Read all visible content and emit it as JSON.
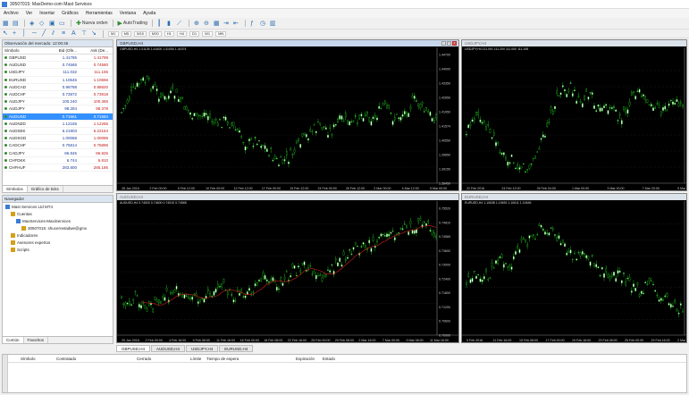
{
  "window": {
    "title": "30507015: MaxDemo-com Mast Services"
  },
  "menu": [
    "Archivo",
    "Ver",
    "Insertar",
    "Gráficos",
    "Herramientas",
    "Ventana",
    "Ayuda"
  ],
  "toolbar": {
    "new_order": "Nueva orden",
    "autotrading": "AutoTrading",
    "timeframes": [
      "M1",
      "M5",
      "M15",
      "M30",
      "H1",
      "H4",
      "D1",
      "W1",
      "MN"
    ]
  },
  "market_watch": {
    "title": "Observación del mercado: 12:00:45",
    "headers": {
      "symbol": "Símbolo",
      "bid": "Bid (Ofe...",
      "ask": "Ask (De..."
    },
    "rows": [
      {
        "symbol": "GBPUSD",
        "bid": "1.41785",
        "ask": "1.41799"
      },
      {
        "symbol": "AUDUSD",
        "bid": "0.74565",
        "ask": "0.74580"
      },
      {
        "symbol": "USDJPY",
        "bid": "111.032",
        "ask": "111.155"
      },
      {
        "symbol": "EURUSD",
        "bid": "1.10645",
        "ask": "1.10656"
      },
      {
        "symbol": "AUDCAD",
        "bid": "0.98788",
        "ask": "0.98820"
      },
      {
        "symbol": "AUDCHF",
        "bid": "0.73872",
        "ask": "0.73918"
      },
      {
        "symbol": "AUDJPY",
        "bid": "100.240",
        "ask": "100.365"
      },
      {
        "symbol": "AUDJPY",
        "bid": "98.284",
        "ask": "98.378"
      },
      {
        "symbol": "AUDUSD",
        "bid": "0.71561",
        "ask": "0.71584"
      },
      {
        "symbol": "AUDNZD",
        "bid": "1.12165",
        "ask": "1.12265"
      },
      {
        "symbol": "AUDSEK",
        "bid": "6.21903",
        "ask": "6.22164"
      },
      {
        "symbol": "AUDSGD",
        "bid": "1.00068",
        "ask": "1.00086"
      },
      {
        "symbol": "CADCHF",
        "bid": "0.75814",
        "ask": "0.75896"
      },
      {
        "symbol": "CADJPY",
        "bid": "86.845",
        "ask": "86.925"
      },
      {
        "symbol": "CHFDKK",
        "bid": "6.744",
        "ask": "6.810"
      },
      {
        "symbol": "CHFHUF",
        "bid": "283.800",
        "ask": "285.186"
      }
    ],
    "selected_index": 8,
    "tabs": [
      "Símbolos",
      "Gráfico de ticks"
    ]
  },
  "navigator": {
    "title": "Navegador",
    "items": [
      {
        "label": "Mast Services Ltd MT4",
        "indent": 0,
        "color": "#3a7bd5"
      },
      {
        "label": "Cuentas",
        "indent": 1,
        "color": "#d4a017"
      },
      {
        "label": "MaxServices-MaxiServices",
        "indent": 2,
        "color": "#3a7bd5"
      },
      {
        "label": "30507015: shucernetadwe@gmx",
        "indent": 3,
        "color": "#d4a017"
      },
      {
        "label": "Indicadores",
        "indent": 1,
        "color": "#d4a017"
      },
      {
        "label": "Asesores expertos",
        "indent": 1,
        "color": "#d4a017"
      },
      {
        "label": "Scripts",
        "indent": 1,
        "color": "#d4a017"
      }
    ],
    "tabs": [
      "Común",
      "Favoritos"
    ]
  },
  "charts": [
    {
      "title": "GBPUSD,H4",
      "info": "GBPUSD,H4  1.41105 1.41600 1.41050 1.41574",
      "active": true,
      "y_labels": [
        "1.44700",
        "1.44000",
        "1.43350",
        "1.42650",
        "1.41950",
        "1.41574",
        "1.40550",
        "1.39850",
        "1.39150",
        "1.38450"
      ],
      "x_labels": [
        "28 Jan 2016",
        "2 Feb 00:00",
        "5 Feb 12:00",
        "10 Feb 00:00",
        "12 Feb 12:00",
        "17 Feb 00:00",
        "19 Feb 12:00",
        "24 Feb 00:00",
        "26 Feb 12:00",
        "2 Mar 00:00",
        "4 Mar 12:00",
        "9 Mar 00:00"
      ]
    },
    {
      "title": "USDJPY,H4",
      "info": "USDJPY,H4  111.091 111.200 111.000 111.155",
      "active": false,
      "y_labels": [],
      "x_labels": [
        "22 Feb 2016",
        "24 Feb 12:00",
        "26 Feb 04:00",
        "1 Mar 00:00",
        "3 Mar 00:00",
        "7 Mar 20:00",
        "9 Mar 00:00"
      ]
    },
    {
      "title": "AUDUSD,H4",
      "info": "AUDUSD,H4  0.74520 0.74600 0.74510 0.74565",
      "active": false,
      "y_labels": [
        "0.75520",
        "0.74810",
        "0.74565",
        "0.73600",
        "0.73000",
        "0.72400",
        "0.71800",
        "0.71200",
        "0.70600",
        "0.70000"
      ],
      "x_labels": [
        "29 Jan 2016",
        "2 Feb 00:00",
        "4 Feb 16:00",
        "9 Feb 08:00",
        "11 Feb 16:00",
        "16 Feb 00:00",
        "18 Feb 08:00",
        "22 Feb 16:00",
        "25 Feb 00:00",
        "29 Feb 08:00",
        "2 Mar 16:00",
        "7 Mar 00:00",
        "9 Mar 08:00",
        "11 Mar 16:00"
      ]
    },
    {
      "title": "EURUSD,H4",
      "info": "EURUSD,H4  1.10638 1.10692 1.10611 1.10645",
      "active": false,
      "y_labels": [],
      "x_labels": [
        "9 Feb 2016",
        "11 Feb 16:00",
        "15 Feb 08:00",
        "17 Feb 00:00",
        "19 Feb 16:00",
        "23 Feb 08:00",
        "25 Feb 00:00",
        "29 Feb 16:00",
        "2 Mar 08:00"
      ]
    }
  ],
  "chart_tabs": [
    "GBPUSD,H4",
    "AUDUSD,H4",
    "USDJPY,H4",
    "EURUSD,H4"
  ],
  "terminal": {
    "headers": [
      "Símbolo",
      "Contratado",
      "Cerrado",
      "Límite",
      "Tiempo de espera",
      "Expiración",
      "Estado"
    ]
  },
  "colors": {
    "bull": "#ffffff",
    "bear": "#22dd22",
    "grid": "#2a2a2a",
    "accent": "#3390ff"
  }
}
